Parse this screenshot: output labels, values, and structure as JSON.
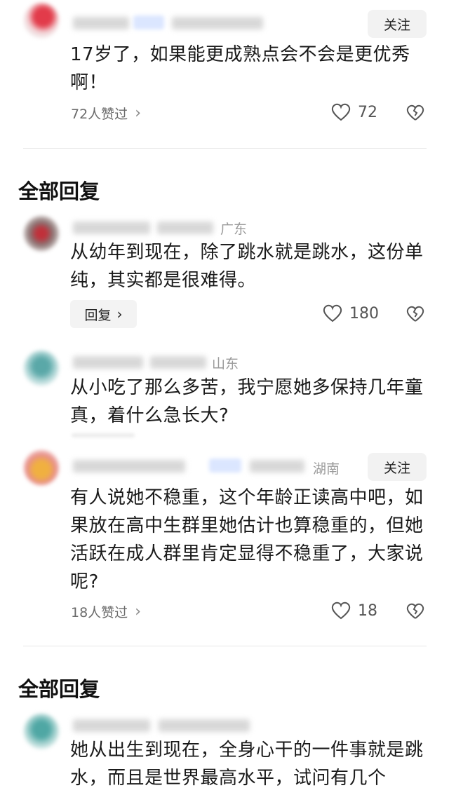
{
  "comment1": {
    "follow_label": "关注",
    "text": "17岁了，如果能更成熟点会不会是更优秀啊！",
    "likes_text": "72人赞过",
    "like_count": "72"
  },
  "section1": {
    "title": "全部回复"
  },
  "reply1": {
    "location": "广东",
    "text": "从幼年到现在，除了跳水就是跳水，这份单纯，其实都是很难得。",
    "reply_label": "回复",
    "like_count": "180"
  },
  "reply2": {
    "location": "山东",
    "text": "从小吃了那么多苦，我宁愿她多保持几年童真，着什么急长大?"
  },
  "comment2": {
    "location": "湖南",
    "follow_label": "关注",
    "text": "有人说她不稳重，这个年龄正读高中吧，如果放在高中生群里她估计也算稳重的，但她活跃在成人群里肯定显得不稳重了，大家说呢?",
    "likes_text": "18人赞过",
    "like_count": "18"
  },
  "section2": {
    "title": "全部回复"
  },
  "reply3": {
    "text": "她从出生到现在，全身心干的一件事就是跳水，而且是世界最高水平，试问有几个"
  },
  "icons": {
    "heart": "heart-icon",
    "broken_heart": "broken-heart-icon",
    "chevron": "chevron-right-icon"
  }
}
